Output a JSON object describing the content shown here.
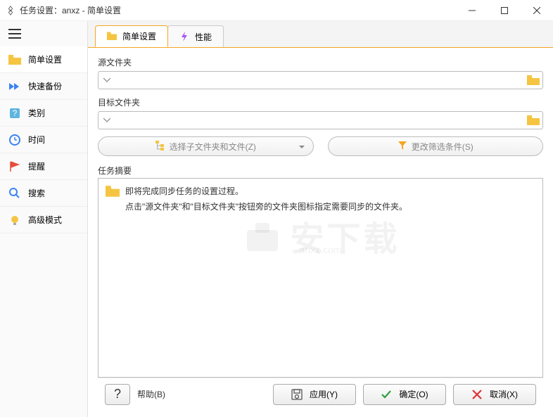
{
  "window": {
    "title": "任务设置：anxz - 简单设置"
  },
  "sidebar": {
    "items": [
      {
        "label": "简单设置"
      },
      {
        "label": "快速备份"
      },
      {
        "label": "类别"
      },
      {
        "label": "时间"
      },
      {
        "label": "提醒"
      },
      {
        "label": "搜索"
      },
      {
        "label": "高级模式"
      }
    ]
  },
  "tabs": {
    "simple": "简单设置",
    "performance": "性能"
  },
  "content": {
    "source_label": "源文件夹",
    "target_label": "目标文件夹",
    "select_subfolders": "选择子文件夹和文件(Z)",
    "change_filter": "更改筛选条件(S)",
    "summary_label": "任务摘要",
    "summary_line1": "即将完成同步任务的设置过程。",
    "summary_line2": "点击\"源文件夹\"和\"目标文件夹\"按钮旁的文件夹图标指定需要同步的文件夹。"
  },
  "footer": {
    "help": "帮助(B)",
    "apply": "应用(Y)",
    "ok": "确定(O)",
    "cancel": "取消(X)"
  }
}
